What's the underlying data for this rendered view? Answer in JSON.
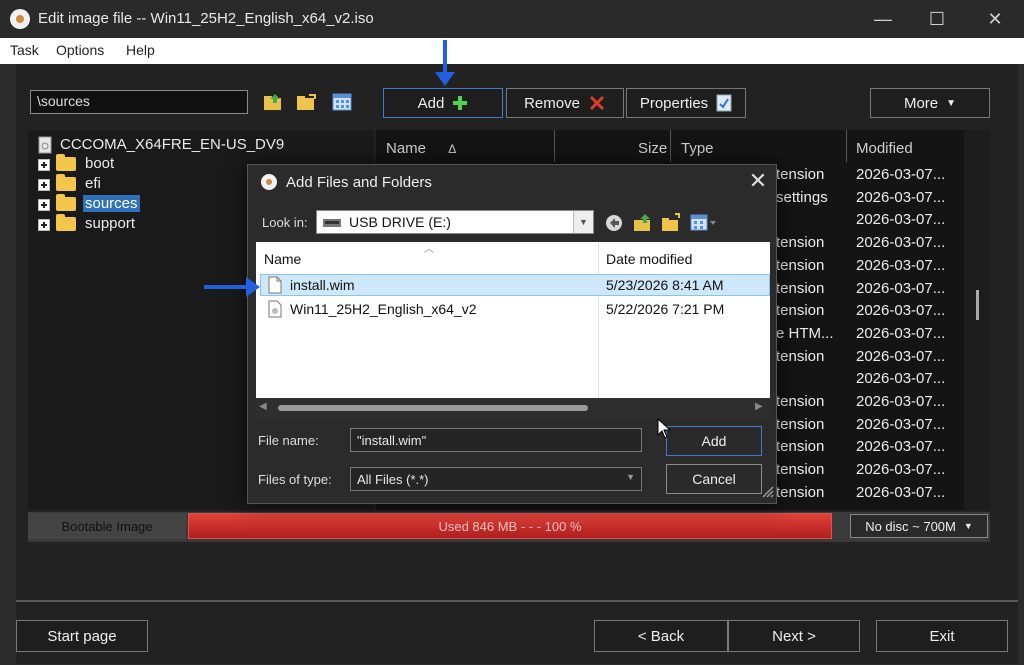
{
  "window": {
    "title": "Edit image file -- Win11_25H2_English_x64_v2.iso",
    "minimize_glyph": "—",
    "maximize_glyph": "☐",
    "close_glyph": "✕"
  },
  "menu": [
    "Task",
    "Options",
    "Help"
  ],
  "toolbar": {
    "path": "\\sources",
    "add_label": "Add",
    "remove_label": "Remove",
    "properties_label": "Properties",
    "more_label": "More",
    "icons": [
      "folder-up-icon",
      "new-folder-icon",
      "view-toggle-icon"
    ]
  },
  "tree": {
    "root": "CCCOMA_X64FRE_EN-US_DV9",
    "items": [
      "boot",
      "efi",
      "sources",
      "support"
    ],
    "selected": "sources"
  },
  "listing": {
    "headers": {
      "name": "Name",
      "size": "Size",
      "type": "Type",
      "modified": "Modified"
    },
    "sort_glyph": "Δ",
    "type_fragments": [
      "tension",
      "settings",
      "",
      "tension",
      "tension",
      "tension",
      "tension",
      "e HTM...",
      "tension",
      "",
      "tension",
      "tension",
      "tension",
      "tension",
      "tension"
    ],
    "modified": [
      "2026-03-07...",
      "2026-03-07...",
      "2026-03-07...",
      "2026-03-07...",
      "2026-03-07...",
      "2026-03-07...",
      "2026-03-07...",
      "2026-03-07...",
      "2026-03-07...",
      "2026-03-07...",
      "2026-03-07...",
      "2026-03-07...",
      "2026-03-07...",
      "2026-03-07...",
      "2026-03-07..."
    ]
  },
  "capacity": {
    "bootable": "Bootable Image",
    "usage": "Used  846 MB  - - -  100 %",
    "disc": "No disc ~ 700M",
    "fill_percent": 100
  },
  "dialog": {
    "title": "Add Files and Folders",
    "close_glyph": "✕",
    "lookin_label": "Look in:",
    "lookin_value": "USB DRIVE (E:)",
    "columns": {
      "name": "Name",
      "date": "Date modified"
    },
    "files": [
      {
        "name": "install.wim",
        "date": "5/23/2026 8:41 AM"
      },
      {
        "name": "Win11_25H2_English_x64_v2",
        "date": "5/22/2026 7:21 PM"
      }
    ],
    "filename_label": "File name:",
    "filename_value": "\"install.wim\"",
    "filetype_label": "Files of type:",
    "filetype_value": "All Files (*.*)",
    "add_label": "Add",
    "cancel_label": "Cancel"
  },
  "nav": {
    "start": "Start page",
    "back": "< Back",
    "next": "Next >",
    "exit": "Exit"
  },
  "colors": {
    "annotation_arrow": "#1f5fe0",
    "selection": "#2f71b8",
    "usage_bar": "#c52a26"
  }
}
